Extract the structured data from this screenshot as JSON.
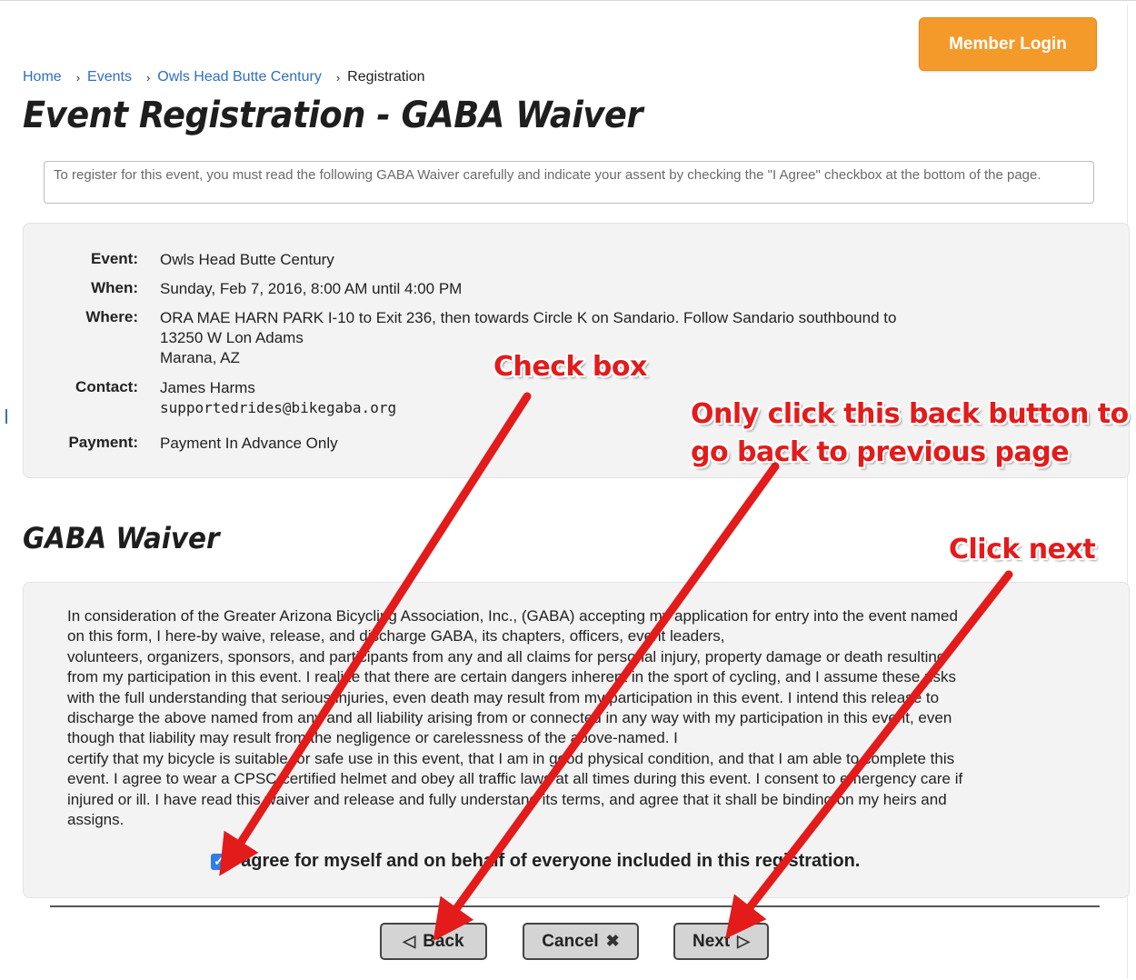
{
  "header": {
    "login_label": "Member Login"
  },
  "breadcrumb": {
    "separator": "›",
    "items": [
      {
        "label": "Home"
      },
      {
        "label": "Events"
      },
      {
        "label": "Owls Head Butte Century"
      }
    ],
    "current": "Registration"
  },
  "page": {
    "title": "Event Registration - GABA Waiver",
    "notice": "To register for this event, you must read the following GABA Waiver carefully and indicate your assent by checking the \"I Agree\" checkbox at the bottom of the page."
  },
  "details": {
    "event_label": "Event:",
    "event_value": "Owls Head Butte Century",
    "when_label": "When:",
    "when_value": "Sunday, Feb 7, 2016, 8:00 AM until 4:00 PM",
    "where_label": "Where:",
    "where_line1": "ORA MAE HARN PARK I-10 to Exit 236, then towards Circle K on Sandario. Follow Sandario southbound to",
    "where_line2": "13250 W Lon Adams",
    "where_line3": "Marana, AZ",
    "contact_label": "Contact:",
    "contact_name": "James Harms",
    "contact_email": "supportedrides@bikegaba.org",
    "payment_label": "Payment:",
    "payment_value": "Payment In Advance Only"
  },
  "waiver": {
    "title": "GABA Waiver",
    "lines": [
      "In consideration of the Greater Arizona Bicycling Association, Inc., (GABA) accepting my application for entry into the event named",
      "on this form, I here-by waive, release, and discharge GABA, its chapters, officers, event leaders,",
      "volunteers, organizers, sponsors, and participants from any and all claims for personal injury, property damage or death resulting",
      "from my participation in this event. I realize that there are certain dangers inherent in the sport of cycling, and I assume these risks",
      "with the full understanding that serious injuries, even death may result from my participation in this event. I intend this release to",
      "discharge the above named from any and all liability arising from or connected in any way with my participation in this event, even",
      "though that liability may result from the negligence or carelessness of the above-named. I",
      "certify that my bicycle is suitable for safe use in this event, that I am in good physical condition, and that I am able to complete this",
      "event. I agree to wear a CPSC-certified helmet and obey all traffic laws at all times during this event. I consent to emergency care if",
      "injured or ill. I have read this waiver and release and fully understand its terms, and agree that it shall be binding on my heirs and",
      "assigns."
    ],
    "agree_label": "I agree for myself and on behalf of everyone included in this registration.",
    "agree_checked": true,
    "check_glyph": "✓"
  },
  "actions": {
    "back_label": "Back",
    "back_icon": "◁",
    "cancel_label": "Cancel",
    "cancel_icon": "✖",
    "next_label": "Next",
    "next_icon": "▷"
  },
  "annotations": {
    "checkbox_callout": "Check box",
    "back_callout_line1": "Only click this back button to",
    "back_callout_line2": "go back to previous page",
    "next_callout": "Click next",
    "arrow_color": "#e31b1b"
  }
}
